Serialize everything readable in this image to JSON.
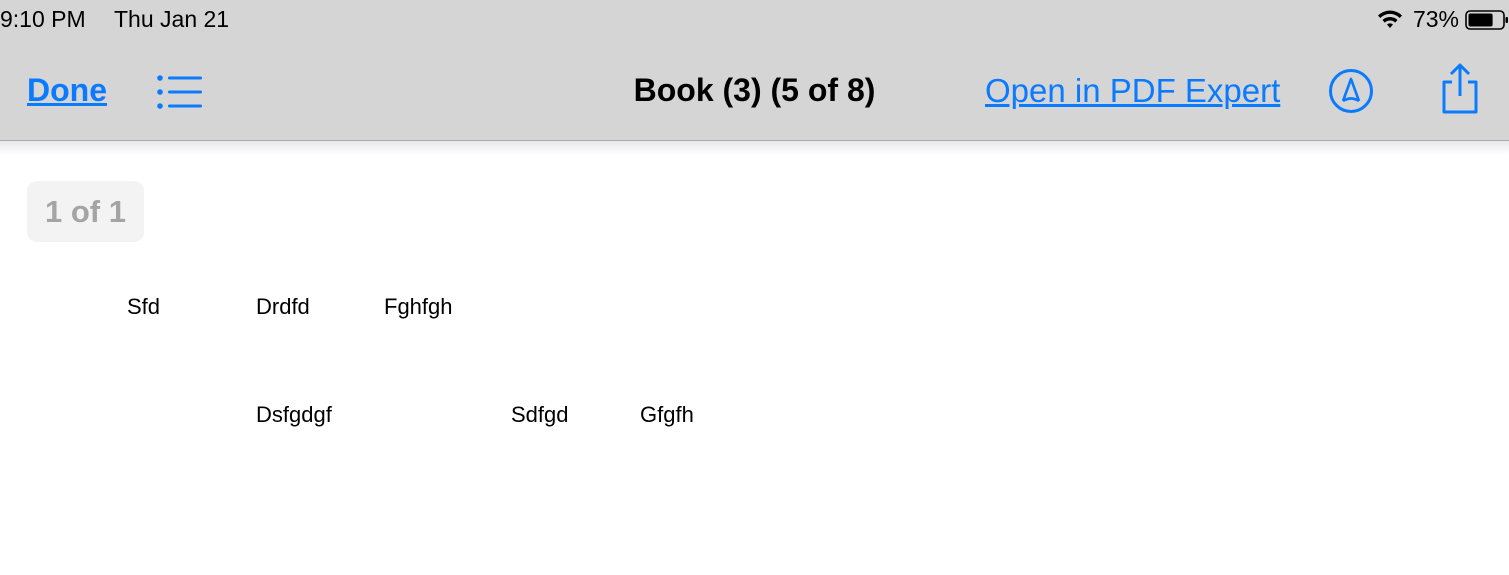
{
  "status_bar": {
    "time": "9:10 PM",
    "date": "Thu Jan 21",
    "battery_percent": "73%",
    "battery_level": 0.73,
    "icons": [
      "wifi-icon",
      "battery-icon"
    ]
  },
  "nav": {
    "done_label": "Done",
    "title": "Book (3) (5 of 8)",
    "open_label": "Open in PDF Expert",
    "icons": [
      "list-icon",
      "markup-icon",
      "share-icon"
    ],
    "accent_color": "#0a7aff"
  },
  "document": {
    "page_indicator": "1 of 1",
    "rows": [
      [
        "Sfd",
        "Drdfd",
        "Fghfgh"
      ],
      [
        "Dsfgdgf",
        "Sdfgd",
        "Gfgfh"
      ]
    ]
  }
}
